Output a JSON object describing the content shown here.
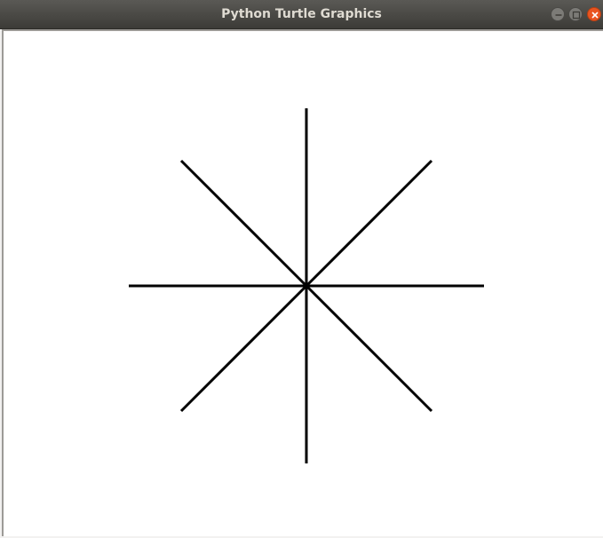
{
  "window": {
    "title": "Python Turtle Graphics"
  },
  "titlebar_buttons": {
    "minimize_icon": "minimize-icon",
    "maximize_icon": "maximize-icon",
    "close_icon": "close-icon"
  },
  "drawing": {
    "description_free": true,
    "stroke_color": "#000000",
    "line_angles_degrees": [
      0,
      45,
      90,
      135,
      180,
      225,
      270,
      315
    ],
    "line_length_units": 200
  },
  "colors": {
    "titlebar": "#3c3b37",
    "title_text": "#dfdbd2",
    "close_button": "#e95420",
    "canvas_background": "#ffffff"
  }
}
